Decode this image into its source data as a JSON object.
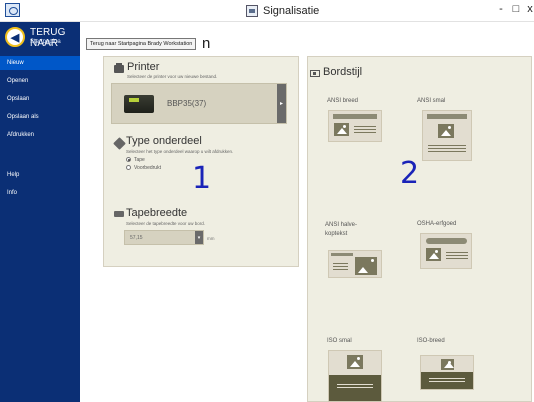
{
  "window": {
    "title": "Signalisatie",
    "controls": [
      "-",
      "□",
      "x"
    ]
  },
  "sidebar": {
    "back_title": "TERUG NAAR",
    "back_subtitle": "Startpagina",
    "items": [
      {
        "label": "Nieuw",
        "active": true
      },
      {
        "label": "Openen",
        "active": false
      },
      {
        "label": "Opslaan",
        "active": false
      },
      {
        "label": "Opslaan als",
        "active": false
      },
      {
        "label": "Afdrukken",
        "active": false
      }
    ],
    "footer_items": [
      {
        "label": "Help"
      },
      {
        "label": "Info"
      }
    ]
  },
  "tooltip": {
    "text": "Terug naar Startpagina Brady Workstation"
  },
  "page_heading_partial": "n",
  "printer": {
    "title": "Printer",
    "subtitle": "Selecteer de printer voor uw nieuwe bestand.",
    "selected": "BBP35(37)"
  },
  "part_type": {
    "title": "Type onderdeel",
    "subtitle": "Selecteer het type onderdeel waarop u wilt afdrukken.",
    "options": [
      {
        "label": "Tape",
        "selected": true
      },
      {
        "label": "Voorbedrukt",
        "selected": false
      }
    ]
  },
  "tape_width": {
    "title": "Tapebreedte",
    "subtitle": "Selecteer de tapebreedte voor uw bord.",
    "value": "57,15",
    "unit": "mm"
  },
  "annotations": {
    "one": "1",
    "two": "2"
  },
  "board_style": {
    "title": "Bordstijl",
    "styles": [
      {
        "label": "ANSI breed"
      },
      {
        "label": "ANSI smal"
      },
      {
        "label": "ANSI halve-\nkoptekst"
      },
      {
        "label": "OSHA-erfgoed"
      },
      {
        "label": "ISO smal"
      },
      {
        "label": "ISO-breed"
      }
    ]
  },
  "colors": {
    "sidebar": "#0b2f75",
    "active_nav": "#0057c8",
    "panel": "#efeee2",
    "accent_number": "#1a23b8"
  }
}
